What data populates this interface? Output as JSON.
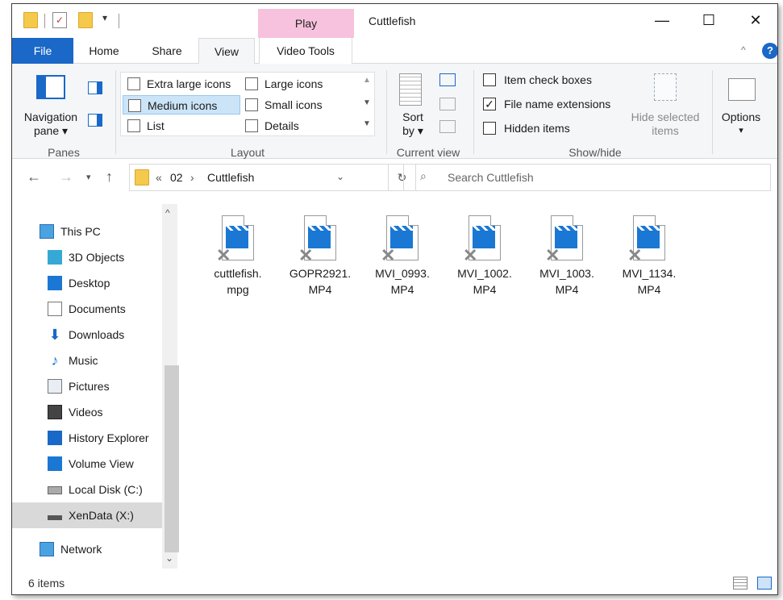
{
  "window": {
    "title": "Cuttlefish",
    "context_tab": "Play",
    "controls": {
      "minimize": "—",
      "maximize": "☐",
      "close": "✕"
    }
  },
  "tabs": [
    {
      "label": "File"
    },
    {
      "label": "Home"
    },
    {
      "label": "Share"
    },
    {
      "label": "View"
    },
    {
      "label": "Video Tools"
    }
  ],
  "ribbon": {
    "panes": {
      "nav_pane_line1": "Navigation",
      "nav_pane_line2": "pane ▾",
      "group": "Panes"
    },
    "layout": {
      "items": [
        {
          "label": "Extra large icons"
        },
        {
          "label": "Large icons"
        },
        {
          "label": "Medium icons"
        },
        {
          "label": "Small icons"
        },
        {
          "label": "List"
        },
        {
          "label": "Details"
        }
      ],
      "selected": "Medium icons",
      "group": "Layout"
    },
    "current_view": {
      "sort_line1": "Sort",
      "sort_line2": "by ▾",
      "group": "Current view"
    },
    "show_hide": {
      "item_check_boxes": {
        "label": "Item check boxes",
        "checked": false
      },
      "file_name_extensions": {
        "label": "File name extensions",
        "checked": true
      },
      "hidden_items": {
        "label": "Hidden items",
        "checked": false
      },
      "hide_selected_line1": "Hide selected",
      "hide_selected_line2": "items",
      "group": "Show/hide"
    },
    "options": {
      "label": "Options",
      "arrow": "▾"
    }
  },
  "address": {
    "prefix": "«",
    "crumbs": [
      "02",
      "Cuttlefish"
    ],
    "separator": "›",
    "search_placeholder": "Search Cuttlefish"
  },
  "nav_items": [
    {
      "label": "This PC",
      "icon": "pc-icon"
    },
    {
      "label": "3D Objects",
      "icon": "cube-icon"
    },
    {
      "label": "Desktop",
      "icon": "desktop-icon"
    },
    {
      "label": "Documents",
      "icon": "documents-icon"
    },
    {
      "label": "Downloads",
      "icon": "downloads-icon"
    },
    {
      "label": "Music",
      "icon": "music-icon"
    },
    {
      "label": "Pictures",
      "icon": "pictures-icon"
    },
    {
      "label": "Videos",
      "icon": "videos-icon"
    },
    {
      "label": "History Explorer",
      "icon": "history-explorer-icon"
    },
    {
      "label": "Volume View",
      "icon": "volume-view-icon"
    },
    {
      "label": "Local Disk (C:)",
      "icon": "local-disk-icon"
    },
    {
      "label": "XenData (X:)",
      "icon": "xendata-drive-icon",
      "selected": true
    },
    {
      "label": "Network",
      "icon": "network-icon"
    }
  ],
  "files": [
    {
      "line1": "cuttlefish.",
      "line2": "mpg"
    },
    {
      "line1": "GOPR2921.",
      "line2": "MP4"
    },
    {
      "line1": "MVI_0993.",
      "line2": "MP4"
    },
    {
      "line1": "MVI_1002.",
      "line2": "MP4"
    },
    {
      "line1": "MVI_1003.",
      "line2": "MP4"
    },
    {
      "line1": "MVI_1134.",
      "line2": "MP4"
    }
  ],
  "status": {
    "count": "6 items"
  }
}
